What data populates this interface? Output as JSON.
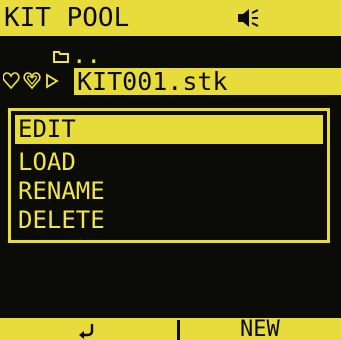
{
  "header": {
    "title": "KIT POOL",
    "speaker_icon": "speaker-mute-icon"
  },
  "browser": {
    "parent_folder_label": "..",
    "parent_folder_icon": "folder-icon",
    "file_row_icons": [
      "heart-outline-icon",
      "heart-double-icon",
      "play-arrow-icon"
    ],
    "selected_file": "KIT001.stk"
  },
  "context_menu": {
    "items": [
      {
        "label": "EDIT",
        "selected": true
      },
      {
        "label": "LOAD",
        "selected": false
      },
      {
        "label": "RENAME",
        "selected": false
      },
      {
        "label": "DELETE",
        "selected": false
      }
    ]
  },
  "footer": {
    "left_softkey_icon": "return-arrow-icon",
    "right_softkey_label": "NEW"
  },
  "colors": {
    "background": "#0b0b07",
    "accent": "#e8dc3c",
    "text": "#f0e448"
  }
}
